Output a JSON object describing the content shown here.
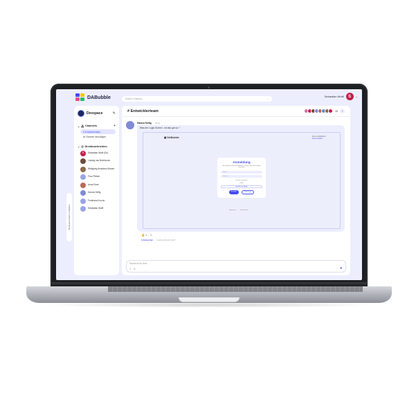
{
  "app": {
    "logo_text": "DABubble",
    "search_placeholder": "Suchen Channel...",
    "user_name": "Sebastian Wolff",
    "user_initial": "S",
    "accent": "#444df2"
  },
  "sidebar": {
    "workspace_name": "Devspace",
    "channels_header": "Channels",
    "channels": [
      "Entwicklerteam",
      "Channel hinzufügen"
    ],
    "dm_header": "Direktnachrichten",
    "dms": [
      {
        "name": "Sebastian Wolff (Du)",
        "color": "#c1204a"
      },
      {
        "name": "Ludwig van Beethoven",
        "color": "#6b4a3a"
      },
      {
        "name": "Wolfgang Amadeus Mozart",
        "color": "#8c6a4a"
      },
      {
        "name": "Frau Pletzer",
        "color": "#9aa4e6"
      },
      {
        "name": "Anna Rose",
        "color": "#b86a5a"
      },
      {
        "name": "Hanna Helfig",
        "color": "#7f8bd6"
      },
      {
        "name": "Ferdinand Kuchs",
        "color": "#9aa4e6"
      },
      {
        "name": "Sebastian Wolff",
        "color": "#9aa4e6"
      }
    ],
    "toggle_label": "Workspace-Menü schließen"
  },
  "channel": {
    "title": "Entwicklerteam",
    "member_count": "13",
    "member_colors": [
      "#d86aa0",
      "#c1204a",
      "#6b4a3a",
      "#7f8bd6",
      "#b86a5a",
      "#5a8ad6",
      "#8c6a4a",
      "#c1204a"
    ]
  },
  "message": {
    "author": "Hanna Helfig",
    "time": "10:01",
    "text": "Was der Login-Screen , ist das gut so ?",
    "reactions": [
      "👍 1",
      "☺"
    ],
    "replies": "2 Antworten",
    "last_reply": "Letzte Antwort 10:27"
  },
  "preview": {
    "logo": "DABubble",
    "corner_line1": "Neu bei DABubble?",
    "corner_line2": "Konto erstellen",
    "title": "Anmeldung",
    "desc": "Wir empfehlen dir die E-Mail-Adresse zu nutzen, die du bei der Arbeit verwendest.",
    "email_ph": "E-Mail",
    "password_ph": "Passwort",
    "forgot": "Passwort vergessen?",
    "or": "ODER",
    "google": "Anmelden mit Google",
    "login_btn": "Anmelden",
    "guest_btn": "Gäste-Login",
    "footer_left": "Impressum",
    "footer_right": "Datenschutz"
  },
  "composer": {
    "placeholder": "Nachricht an Dein..."
  }
}
